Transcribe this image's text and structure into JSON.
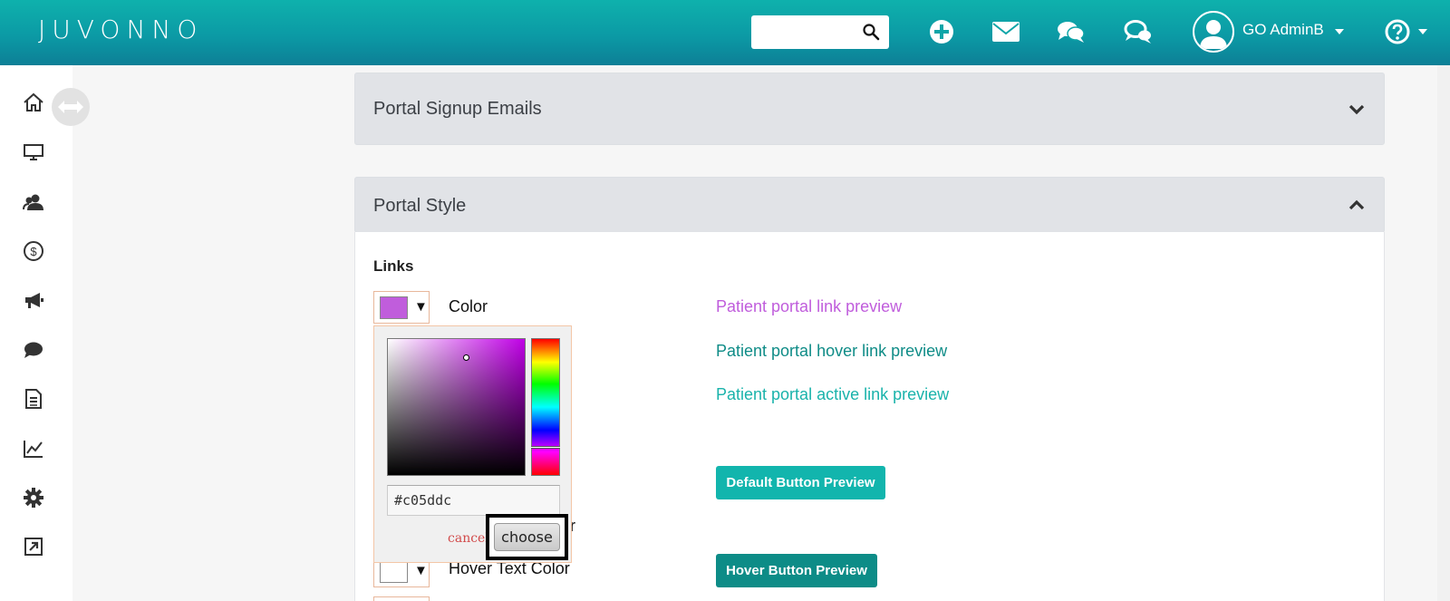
{
  "app": {
    "logo_text": "JUVONNO"
  },
  "header": {
    "search": {
      "placeholder": ""
    },
    "user_name": "GO AdminB",
    "icons": [
      "plus-circle-icon",
      "envelope-icon",
      "chat-bubbles-icon",
      "messages-icon",
      "help-icon"
    ]
  },
  "sidebar": {
    "icons": [
      "home-icon",
      "monitor-icon",
      "users-icon",
      "dollar-icon",
      "megaphone-icon",
      "chat-icon",
      "document-icon",
      "chart-icon",
      "gear-icon",
      "external-link-icon"
    ]
  },
  "panels": {
    "signup": {
      "title": "Portal Signup Emails"
    },
    "style": {
      "title": "Portal Style"
    }
  },
  "links_section": {
    "heading": "Links",
    "color_label": "Color",
    "link_preview": "Patient portal link preview",
    "hover_link_preview": "Patient portal hover link preview",
    "active_link_preview": "Patient portal active link preview",
    "default_button_preview": "Default Button Preview",
    "hover_button_preview": "Hover Button Preview",
    "partial_label": "r",
    "hover_text_color_label": "Hover Text Color"
  },
  "colors": {
    "link_color": "#c05ddc",
    "hover_link_color": "#0f8c87",
    "active_link_color": "#1ab3ab",
    "default_button_bg": "#12b5ad",
    "hover_button_bg": "#0d8c87",
    "hover_text_swatch": "#ffffff"
  },
  "color_picker": {
    "hex_value": "#c05ddc",
    "cancel_label": "cancel",
    "choose_label": "choose"
  }
}
